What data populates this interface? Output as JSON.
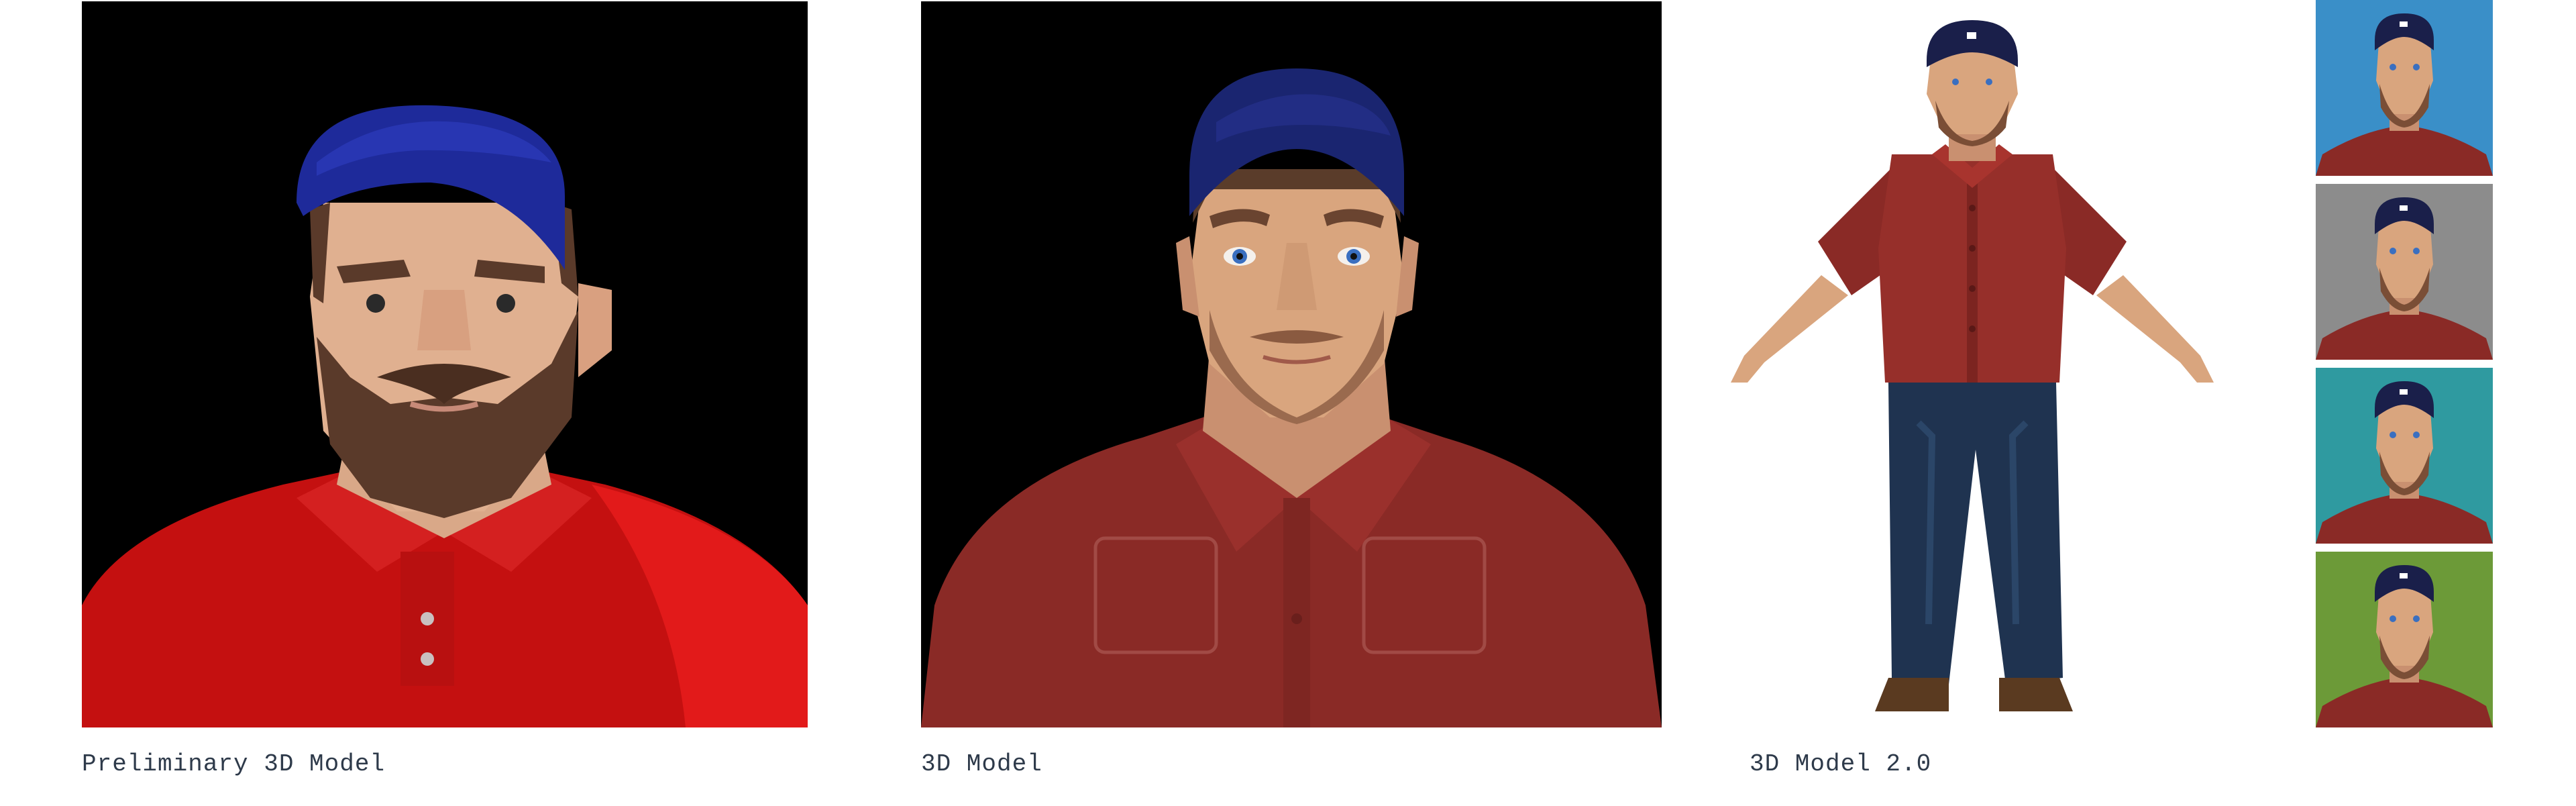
{
  "captions": {
    "preliminary": "Preliminary 3D Model",
    "model": "3D Model",
    "model_v2": "3D Model 2.0"
  },
  "colors": {
    "panel_bg": "#000000",
    "page_bg": "#ffffff",
    "cap_blue": "#1e2a9a",
    "cap_navy": "#1a1f4a",
    "shirt_red_bright": "#d01010",
    "shirt_red_muted": "#8a2a26",
    "jeans_blue": "#1f3350",
    "thumb_backgrounds": [
      "#3a8fc8",
      "#8c8c8c",
      "#2f9aa0",
      "#6c9a38"
    ]
  },
  "icons": [
    "avatar-preliminary-image",
    "avatar-3d-model-image",
    "avatar-full-body-image",
    "avatar-thumbnail-image"
  ]
}
